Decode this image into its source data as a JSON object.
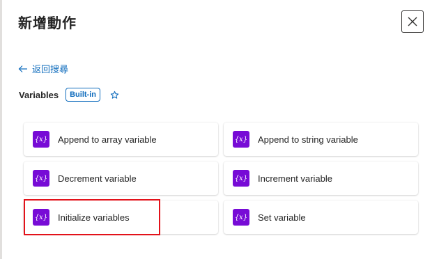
{
  "panel": {
    "title": "新增動作",
    "close_icon": "close-icon",
    "back_label": "返回搜尋",
    "back_icon": "arrow-left-icon"
  },
  "connector": {
    "name": "Variables",
    "badge": "Built-in",
    "favorite_icon": "star-outline-icon",
    "accent_color": "#0f6cbd",
    "icon_color": "#770bd6"
  },
  "actions": [
    {
      "label": "Append to array variable",
      "icon_text": "{x}"
    },
    {
      "label": "Append to string variable",
      "icon_text": "{x}"
    },
    {
      "label": "Decrement variable",
      "icon_text": "{x}"
    },
    {
      "label": "Increment variable",
      "icon_text": "{x}"
    },
    {
      "label": "Initialize variables",
      "icon_text": "{x}",
      "highlighted": true,
      "highlight_color": "#e3121a"
    },
    {
      "label": "Set variable",
      "icon_text": "{x}"
    }
  ]
}
